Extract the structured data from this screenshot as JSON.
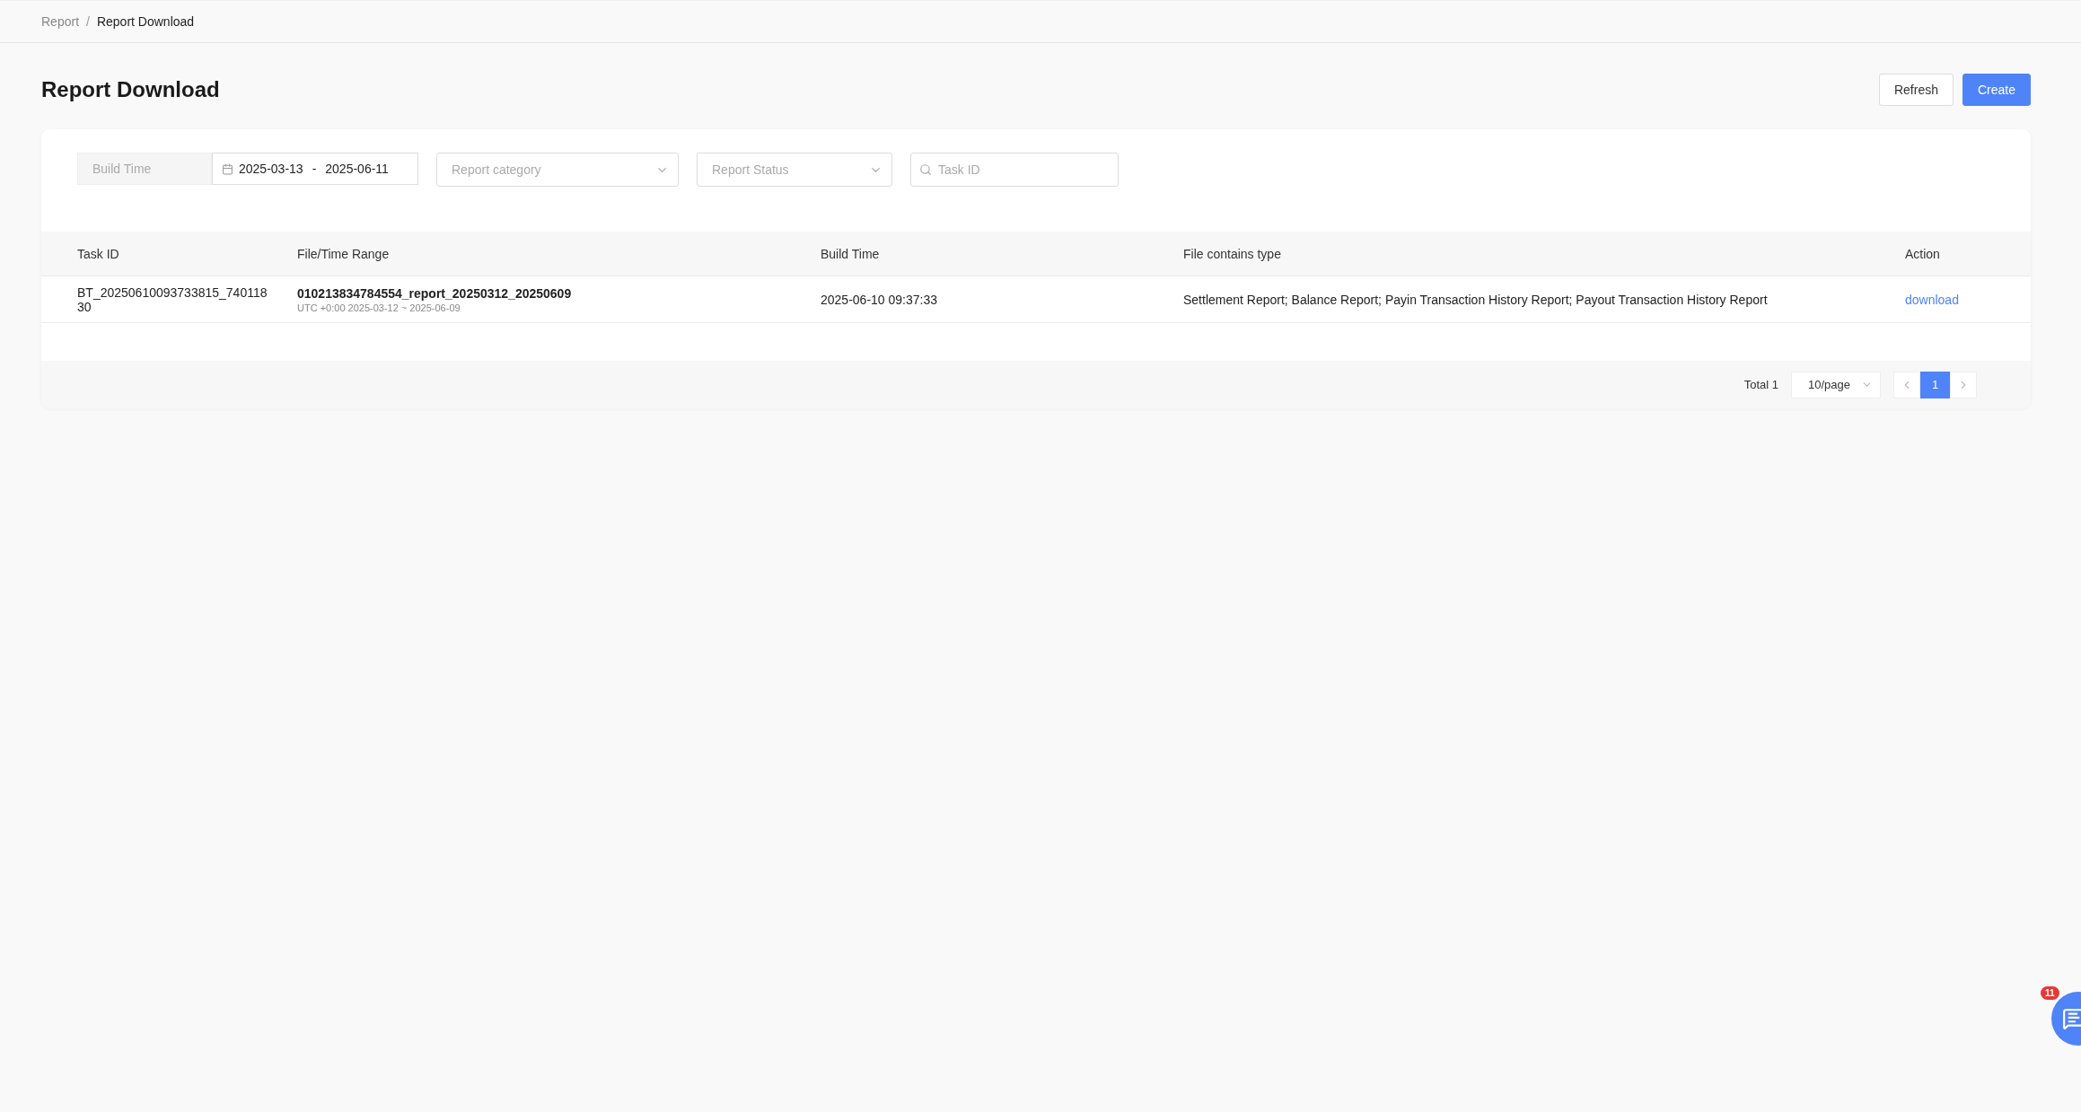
{
  "breadcrumb": [
    {
      "label": "Report",
      "current": false
    },
    {
      "label": "Report Download",
      "current": true
    }
  ],
  "breadcrumb_separator": "/",
  "page_title": "Report Download",
  "header_buttons": [
    {
      "label": "Refresh",
      "kind": "default"
    },
    {
      "label": "Create",
      "kind": "primary"
    }
  ],
  "filters": {
    "build_time_label": "Build Time",
    "date_start": "2025-03-13",
    "date_separator": "-",
    "date_end": "2025-06-11",
    "category_placeholder": "Report category",
    "status_placeholder": "Report Status",
    "task_id_placeholder": "Task ID"
  },
  "table": {
    "columns": [
      "Task ID",
      "File/Time Range",
      "Build Time",
      "File contains type",
      "Action"
    ],
    "rows": [
      {
        "task_id": "BT_20250610093733815_74011830",
        "file_name": "010213834784554_report_20250312_20250609",
        "time_range": "UTC +0:00 2025-03-12 ~ 2025-06-09",
        "build_time": "2025-06-10 09:37:33",
        "file_types": "Settlement Report; Balance Report; Payin Transaction History Report; Payout Transaction History Report",
        "action": "download"
      }
    ]
  },
  "pagination": {
    "total": "Total 1",
    "page_size": "10/page",
    "pages": [
      {
        "label": "1",
        "selected": true
      }
    ]
  },
  "chat": {
    "badge": "11"
  }
}
